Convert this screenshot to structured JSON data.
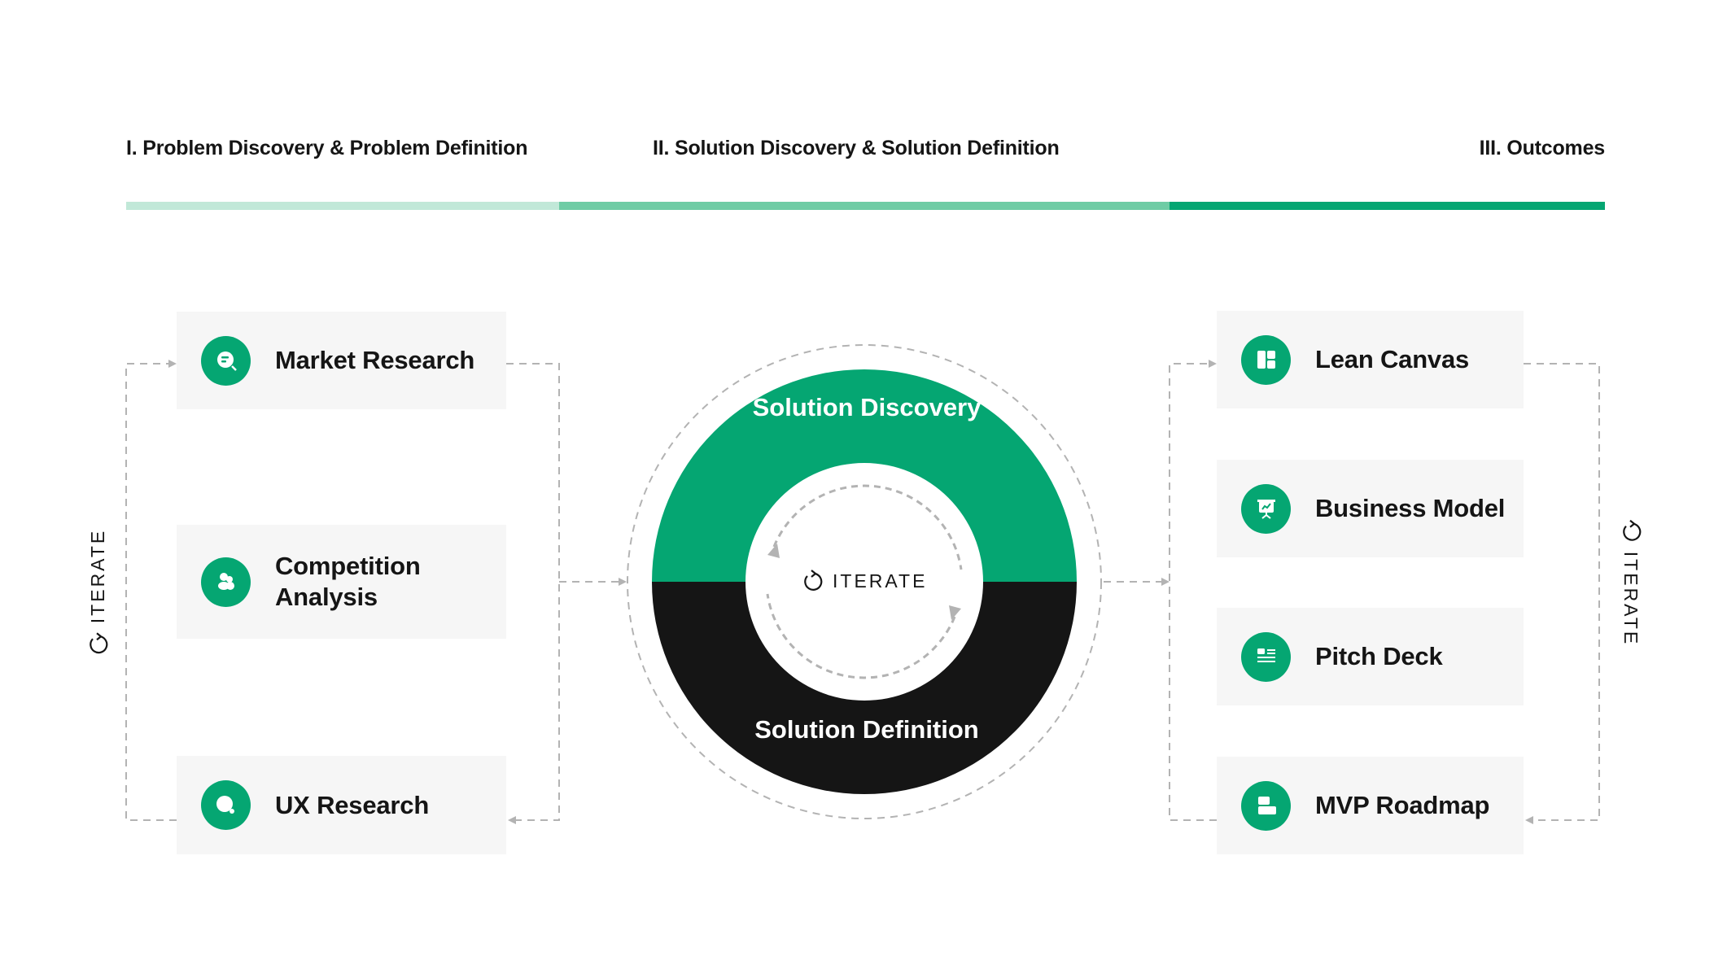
{
  "phases": [
    {
      "label": "I. Problem Discovery & Problem Definition",
      "color": "#c1e8d8"
    },
    {
      "label": "II. Solution Discovery & Solution Definition",
      "color": "#6fcca5"
    },
    {
      "label": "III. Outcomes",
      "color": "#05a672"
    }
  ],
  "left_cards": [
    {
      "label": "Market Research",
      "icon": "search-document-icon"
    },
    {
      "label": "Competition Analysis",
      "icon": "users-icon"
    },
    {
      "label": "UX Research",
      "icon": "magnifier-icon"
    }
  ],
  "cycle": {
    "top_label": "Solution Discovery",
    "bottom_label": "Solution Definition",
    "center_label": "ITERATE",
    "top_color": "#05a672",
    "bottom_color": "#151515"
  },
  "right_cards": [
    {
      "label": "Lean Canvas",
      "icon": "layout-icon"
    },
    {
      "label": "Business Model",
      "icon": "presentation-chart-icon"
    },
    {
      "label": "Pitch Deck",
      "icon": "document-list-icon"
    },
    {
      "label": "MVP Roadmap",
      "icon": "roadmap-blocks-icon"
    }
  ],
  "side_labels": {
    "left": "ITERATE",
    "right": "ITERATE"
  },
  "colors": {
    "accent": "#05a672",
    "dark": "#151515",
    "card_bg": "#f6f6f6",
    "dash": "#b3b3b3"
  }
}
